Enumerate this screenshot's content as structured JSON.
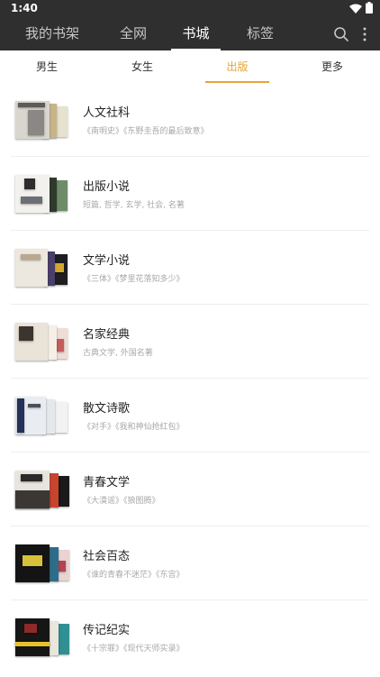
{
  "status_bar": {
    "time": "1:40",
    "icons": [
      "wifi-icon",
      "battery-icon"
    ]
  },
  "top_nav": {
    "tabs": [
      {
        "label": "我的书架"
      },
      {
        "label": "全网"
      },
      {
        "label": "书城",
        "active": true
      },
      {
        "label": "标签"
      }
    ],
    "icons": [
      "search-icon",
      "more-vertical-icon"
    ]
  },
  "sub_nav": {
    "tabs": [
      {
        "label": "男生"
      },
      {
        "label": "女生"
      },
      {
        "label": "出版",
        "active": true
      },
      {
        "label": "更多"
      }
    ]
  },
  "categories": [
    {
      "title": "人文社科",
      "desc": "《南明史》《东野圭吾的最后致意》"
    },
    {
      "title": "出版小说",
      "desc": "短篇, 哲学, 玄学, 社会, 名著"
    },
    {
      "title": "文学小说",
      "desc": "《三体》《梦里花落知多少》"
    },
    {
      "title": "名家经典",
      "desc": "古典文学, 外国名著"
    },
    {
      "title": "散文诗歌",
      "desc": "《对手》《我和神仙抢红包》"
    },
    {
      "title": "青春文学",
      "desc": "《大漠谣》《狼图腾》"
    },
    {
      "title": "社会百态",
      "desc": "《谁的青春不迷茫》《东宫》"
    },
    {
      "title": "传记纪实",
      "desc": "《十宗罪》《现代天师实录》"
    }
  ],
  "colors": {
    "header_bg": "#2f2f2f",
    "accent": "#e8a33a",
    "title_text": "#222222",
    "desc_text": "#a8a8a8",
    "divider": "#eeeeee"
  }
}
